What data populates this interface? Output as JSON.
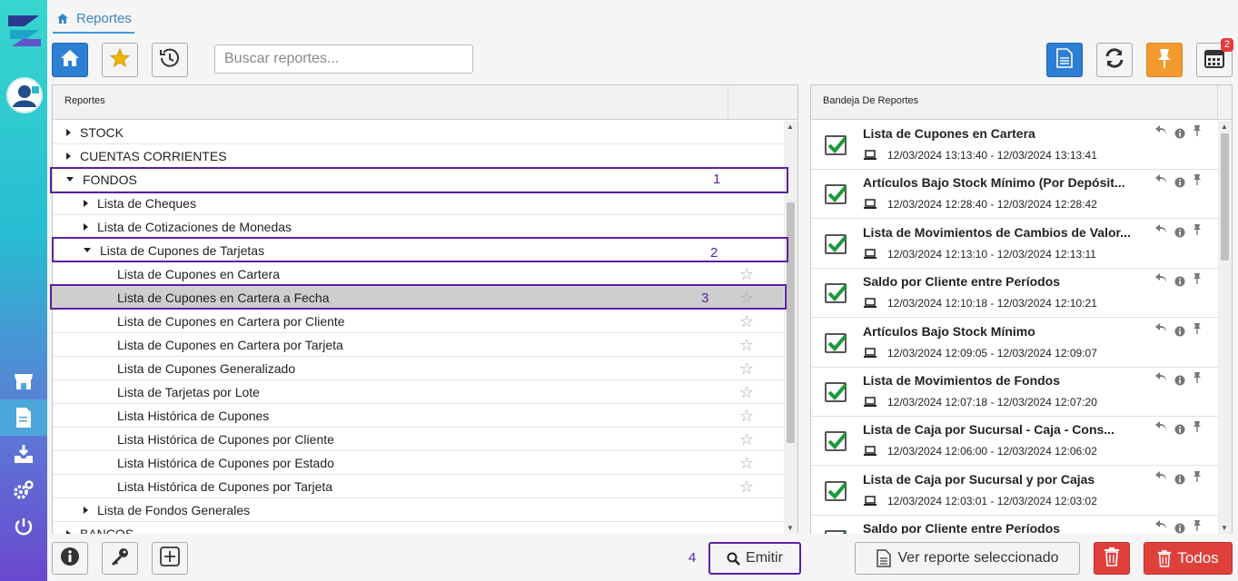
{
  "tab": {
    "label": "Reportes"
  },
  "search": {
    "placeholder": "Buscar reportes..."
  },
  "toolbar": {
    "calendar_badge": "2"
  },
  "left_panel": {
    "header": "Reportes"
  },
  "tree": [
    {
      "label": "STOCK",
      "level": 0,
      "caret": "right",
      "star": false,
      "selected": false
    },
    {
      "label": "CUENTAS CORRIENTES",
      "level": 0,
      "caret": "right",
      "star": false,
      "selected": false
    },
    {
      "label": "FONDOS",
      "level": 0,
      "caret": "down",
      "star": false,
      "selected": false
    },
    {
      "label": "Lista de Cheques",
      "level": 1,
      "caret": "right",
      "star": false,
      "selected": false
    },
    {
      "label": "Lista de Cotizaciones de Monedas",
      "level": 1,
      "caret": "right",
      "star": false,
      "selected": false
    },
    {
      "label": "Lista de Cupones de Tarjetas",
      "level": 1,
      "caret": "down",
      "star": false,
      "selected": false
    },
    {
      "label": "Lista de Cupones en Cartera",
      "level": 2,
      "caret": "none",
      "star": true,
      "selected": false
    },
    {
      "label": "Lista de Cupones en Cartera a Fecha",
      "level": 2,
      "caret": "none",
      "star": true,
      "selected": true
    },
    {
      "label": "Lista de Cupones en Cartera por Cliente",
      "level": 2,
      "caret": "none",
      "star": true,
      "selected": false
    },
    {
      "label": "Lista de Cupones en Cartera por Tarjeta",
      "level": 2,
      "caret": "none",
      "star": true,
      "selected": false
    },
    {
      "label": "Lista de Cupones Generalizado",
      "level": 2,
      "caret": "none",
      "star": true,
      "selected": false
    },
    {
      "label": "Lista de Tarjetas por Lote",
      "level": 2,
      "caret": "none",
      "star": true,
      "selected": false
    },
    {
      "label": "Lista Histórica de Cupones",
      "level": 2,
      "caret": "none",
      "star": true,
      "selected": false
    },
    {
      "label": "Lista Histórica de Cupones por Cliente",
      "level": 2,
      "caret": "none",
      "star": true,
      "selected": false
    },
    {
      "label": "Lista Histórica de Cupones por Estado",
      "level": 2,
      "caret": "none",
      "star": true,
      "selected": false
    },
    {
      "label": "Lista Histórica de Cupones por Tarjeta",
      "level": 2,
      "caret": "none",
      "star": true,
      "selected": false
    },
    {
      "label": "Lista de Fondos Generales",
      "level": 1,
      "caret": "right",
      "star": false,
      "selected": false
    },
    {
      "label": "BANCOS",
      "level": 0,
      "caret": "right",
      "star": false,
      "selected": false
    }
  ],
  "annotations": {
    "n1": "1",
    "n2": "2",
    "n3": "3",
    "n4": "4"
  },
  "right_panel": {
    "header": "Bandeja De Reportes"
  },
  "tray": [
    {
      "title": "Lista de Cupones en Cartera",
      "dates": "12/03/2024 13:13:40 - 12/03/2024 13:13:41"
    },
    {
      "title": "Artículos Bajo Stock Mínimo (Por Depósit...",
      "dates": "12/03/2024 12:28:40 - 12/03/2024 12:28:42"
    },
    {
      "title": "Lista de Movimientos de Cambios de Valor...",
      "dates": "12/03/2024 12:13:10 - 12/03/2024 12:13:11"
    },
    {
      "title": "Saldo por Cliente entre Períodos",
      "dates": "12/03/2024 12:10:18 - 12/03/2024 12:10:21"
    },
    {
      "title": "Artículos Bajo Stock Mínimo",
      "dates": "12/03/2024 12:09:05 - 12/03/2024 12:09:07"
    },
    {
      "title": "Lista de Movimientos de Fondos",
      "dates": "12/03/2024 12:07:18 - 12/03/2024 12:07:20"
    },
    {
      "title": "Lista de Caja por Sucursal - Caja - Cons...",
      "dates": "12/03/2024 12:06:00 - 12/03/2024 12:06:02"
    },
    {
      "title": "Lista de Caja por Sucursal y por Cajas",
      "dates": "12/03/2024 12:03:01 - 12/03/2024 12:03:02"
    },
    {
      "title": "Saldo por Cliente entre Períodos",
      "dates": ""
    }
  ],
  "bottom": {
    "emitir": "Emitir",
    "ver_reporte": "Ver reporte seleccionado",
    "todos": "Todos"
  },
  "colors": {
    "accent": "#2d7fd3",
    "highlight": "#5b1fa6",
    "danger": "#e0403c",
    "warning": "#f39a2f",
    "success": "#1a9a3a"
  }
}
